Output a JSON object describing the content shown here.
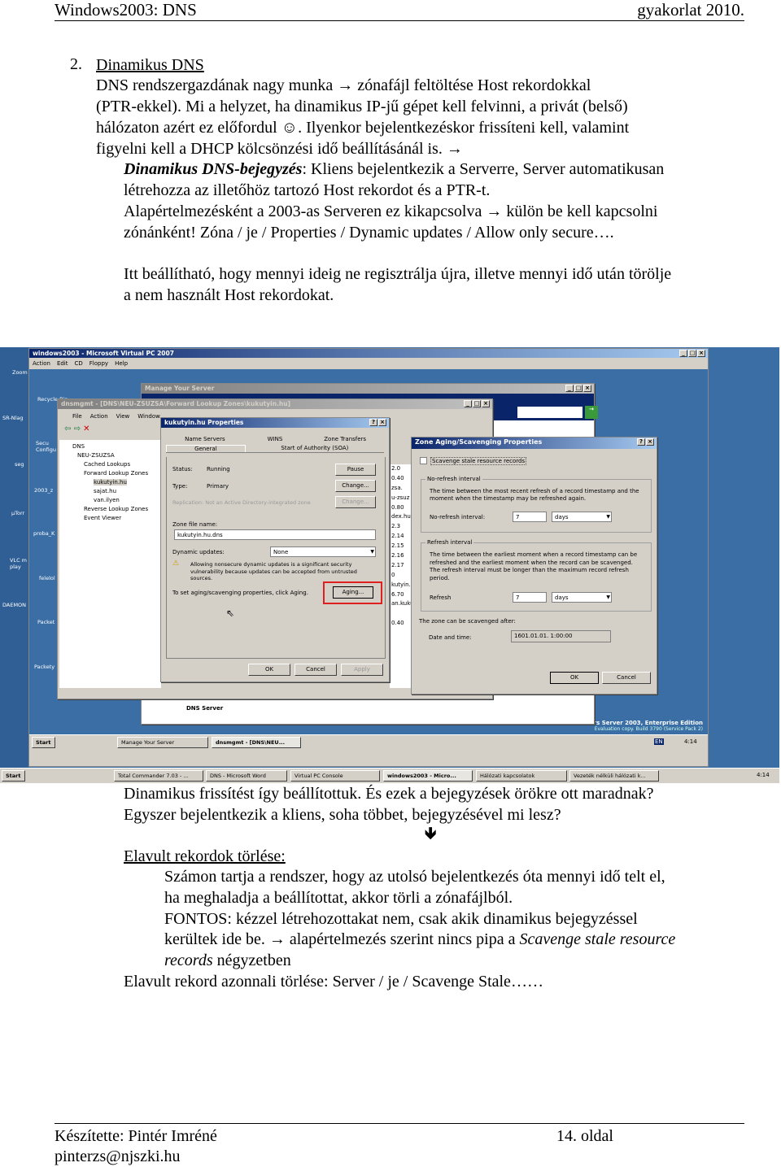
{
  "header": {
    "left": "Windows2003: DNS",
    "right": "gyakorlat 2010."
  },
  "section": {
    "number": "2.",
    "title": "Dinamikus DNS",
    "lines": [
      "DNS rendszergazdának nagy munka → zónafájl feltöltése Host rekordokkal",
      "(PTR-ekkel). Mi a helyzet, ha dinamikus IP-jű gépet kell felvinni, a privát (belső)",
      "hálózaton azért ez előfordul ☺. Ilyenkor bejelentkezéskor frissíteni kell, valamint",
      "figyelni kell a DHCP kölcsönzési idő beállításánál is. →"
    ],
    "def_term": "Dinamikus DNS-bejegyzés",
    "def_lines": [
      ": Kliens bejelentkezik a Serverre, Server automatikusan",
      "létrehozza az illetőhöz tartozó Host rekordot és a PTR-t.",
      "Alapértelmezésként a 2003-as Serveren ez kikapcsolva → külön be kell kapcsolni",
      "zónánként! Zóna / je / Properties / Dynamic updates / Allow only secure…."
    ],
    "aging_lines": [
      "Itt beállítható, hogy mennyi ideig ne regisztrálja újra, illetve mennyi idő után törölje",
      "a nem használt Host rekordokat."
    ]
  },
  "after": {
    "lines": [
      "Dinamikus frissítést így beállítottuk. És ezek a bejegyzések örökre ott maradnak?",
      "Egyszer bejelentkezik a kliens, soha többet, bejegyzésével mi lesz?"
    ],
    "arrow": "🡻",
    "subtitle": "Elavult rekordok törlése:",
    "sub_lines": [
      "Számon tartja a rendszer, hogy az utolsó bejelentkezés óta mennyi idő telt el,",
      "ha meghaladja a beállítottat, akkor törli a zónafájlból.",
      "FONTOS: kézzel létrehozottakat nem, csak akik dinamikus bejegyzéssel",
      "kerültek ide be. → alapértelmezés szerint nincs pipa a "
    ],
    "italic_1": "Scavenge stale resource",
    "italic_2": "records",
    "tail": " négyzetben",
    "last": "Elavult rekord azonnali törlése: Server / je / Scavenge Stale……"
  },
  "footer": {
    "author": "Készítette: Pintér Imréné",
    "email": "pinterzs@njszki.hu",
    "page": "14. oldal"
  },
  "screenshot": {
    "outer_icons": [
      "Zoom",
      "SR-Nlag",
      "seg",
      "µTorr",
      "VLC m play",
      "DAEMON"
    ],
    "vpc": {
      "title": "windows2003 - Microsoft Virtual PC 2007",
      "menu": [
        "Action",
        "Edit",
        "CD",
        "Floppy",
        "Help"
      ]
    },
    "inner_icons": [
      "Recycle Bin",
      "Secu Configu",
      "2003_z",
      "proba_K",
      "felelol",
      "Packet",
      "Packety"
    ],
    "manage_server": {
      "title": "Manage Your Server",
      "dns_server": "DNS Server"
    },
    "dnsmgmt": {
      "title": "dnsmgmt - [DNS\\NEU-ZSUZSA\\Forward Lookup Zones\\kukutyin.hu]",
      "menu": [
        "File",
        "Action",
        "View",
        "Window"
      ],
      "tree": [
        "DNS",
        "NEU-ZSUZSA",
        "Cached Lookups",
        "Forward Lookup Zones",
        "kukutyin.hu",
        "sajat.hu",
        "van.ilyen",
        "Reverse Lookup Zones",
        "Event Viewer"
      ],
      "list": [
        "2.0",
        "0.40",
        "zsa.",
        "u-zsuz",
        "0.80",
        "dex.hu.",
        "2.3",
        "2.14",
        "2.15",
        "2.16",
        "2.17",
        "0",
        "kutyin.",
        "6.70",
        "an.kuku",
        "",
        "0.40"
      ]
    },
    "props": {
      "title": "kukutyin.hu Properties",
      "tabs_back": [
        "Name Servers",
        "WINS",
        "Zone Transfers"
      ],
      "tabs_front": [
        "General",
        "Start of Authority (SOA)"
      ],
      "status_label": "Status:",
      "status": "Running",
      "type_label": "Type:",
      "type": "Primary",
      "replication": "Replication: Not an Active Directory-integrated zone",
      "pause": "Pause",
      "change": "Change...",
      "change2": "Change...",
      "zone_file_label": "Zone file name:",
      "zone_file": "kukutyin.hu.dns",
      "dyn_label": "Dynamic updates:",
      "dyn_value": "None",
      "warning": "Allowing nonsecure dynamic updates is a significant security vulnerability because updates can be accepted from untrusted sources.",
      "aging_text": "To set aging/scavenging properties, click Aging.",
      "aging": "Aging...",
      "ok": "OK",
      "cancel": "Cancel",
      "apply": "Apply"
    },
    "aging": {
      "title": "Zone Aging/Scavenging Properties",
      "scavenge": "Scavenge stale resource records",
      "scavenge_checked": false,
      "norefresh_group": "No-refresh interval",
      "norefresh_desc": "The time between the most recent refresh of a record timestamp and the moment when the timestamp may be refreshed again.",
      "norefresh_label": "No-refresh interval:",
      "norefresh_value": "7",
      "norefresh_unit": "days",
      "refresh_group": "Refresh interval",
      "refresh_desc": "The time between the earliest moment when a record timestamp can be refreshed and the earliest moment when the record can be scavenged. The refresh interval must be longer than the maximum record refresh period.",
      "refresh_label": "Refresh",
      "refresh_value": "7",
      "refresh_unit": "days",
      "scav_after": "The zone can be scavenged after:",
      "date_label": "Date and time:",
      "date_value": "1601.01.01. 1:00:00",
      "ok": "OK",
      "cancel": "Cancel"
    },
    "branding": {
      "line1": "rs Server 2003, Enterprise Edition",
      "line2": "Evaluation copy. Build 3790 (Service Pack 2)"
    },
    "inner_taskbar": {
      "start": "Start",
      "items": [
        "Manage Your Server",
        "dnsmgmt - [DNS\\NEU..."
      ],
      "lang": "EN",
      "clock": "4:14"
    },
    "outer_taskbar": {
      "start": "Start",
      "items": [
        "Total Commander 7.03 - ...",
        "DNS - Microsoft Word",
        "Virtual PC Console",
        "windows2003 - Micro...",
        "Hálózati kapcsolatok",
        "Vezeték nélküli hálózati k..."
      ],
      "clock": "4:14"
    },
    "highlight_color": "#e02020"
  }
}
